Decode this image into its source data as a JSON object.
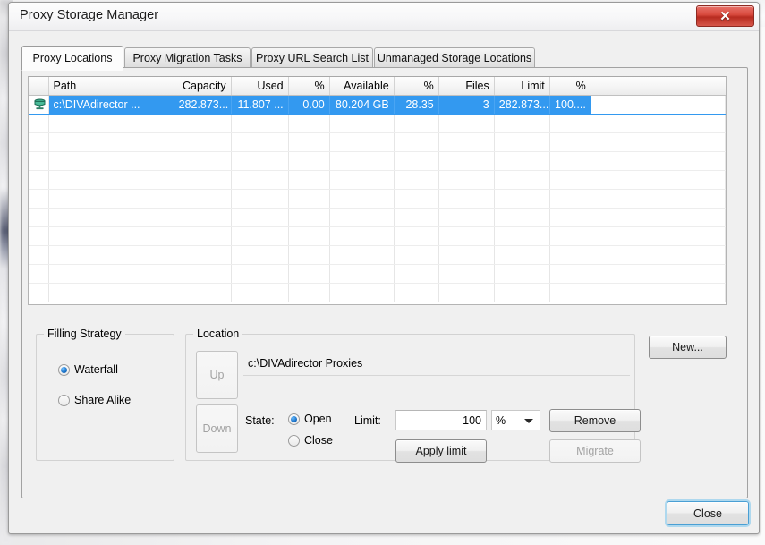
{
  "window": {
    "title": "Proxy Storage Manager",
    "close_glyph": "✕",
    "close_button_name": "close-window"
  },
  "tabs": [
    {
      "label": "Proxy Locations",
      "active": true
    },
    {
      "label": "Proxy Migration Tasks",
      "active": false
    },
    {
      "label": "Proxy URL Search List",
      "active": false
    },
    {
      "label": "Unmanaged Storage Locations",
      "active": false
    }
  ],
  "table": {
    "columns": [
      "Path",
      "Capacity",
      "Used",
      "%",
      "Available",
      "%",
      "Files",
      "Limit",
      "%"
    ],
    "rows": [
      {
        "icon": "storage-drive-icon",
        "selected": true,
        "cells": [
          "c:\\DIVAdirector ...",
          "282.873...",
          "11.807 ...",
          "0.00",
          "80.204 GB",
          "28.35",
          "3",
          "282.873...",
          "100...."
        ]
      }
    ],
    "empty_row_count": 10
  },
  "filling_strategy": {
    "title": "Filling Strategy",
    "options": [
      {
        "label": "Waterfall",
        "selected": true
      },
      {
        "label": "Share Alike",
        "selected": false
      }
    ]
  },
  "location": {
    "title": "Location",
    "up_button": "Up",
    "down_button": "Down",
    "path_value": "c:\\DIVAdirector Proxies",
    "state_label": "State:",
    "state_options": [
      {
        "label": "Open",
        "selected": true
      },
      {
        "label": "Close",
        "selected": false
      }
    ],
    "limit_label": "Limit:",
    "limit_value": "100",
    "limit_unit": "%",
    "apply_limit_button": "Apply limit",
    "remove_button": "Remove",
    "migrate_button": "Migrate"
  },
  "side_actions": {
    "new_button": "New..."
  },
  "footer": {
    "close_button": "Close"
  },
  "colors": {
    "selection_blue": "#3399f0",
    "close_red": "#c8392c",
    "focus_ring": "#aed8ee",
    "dialog_bg": "#f0f0f0"
  }
}
